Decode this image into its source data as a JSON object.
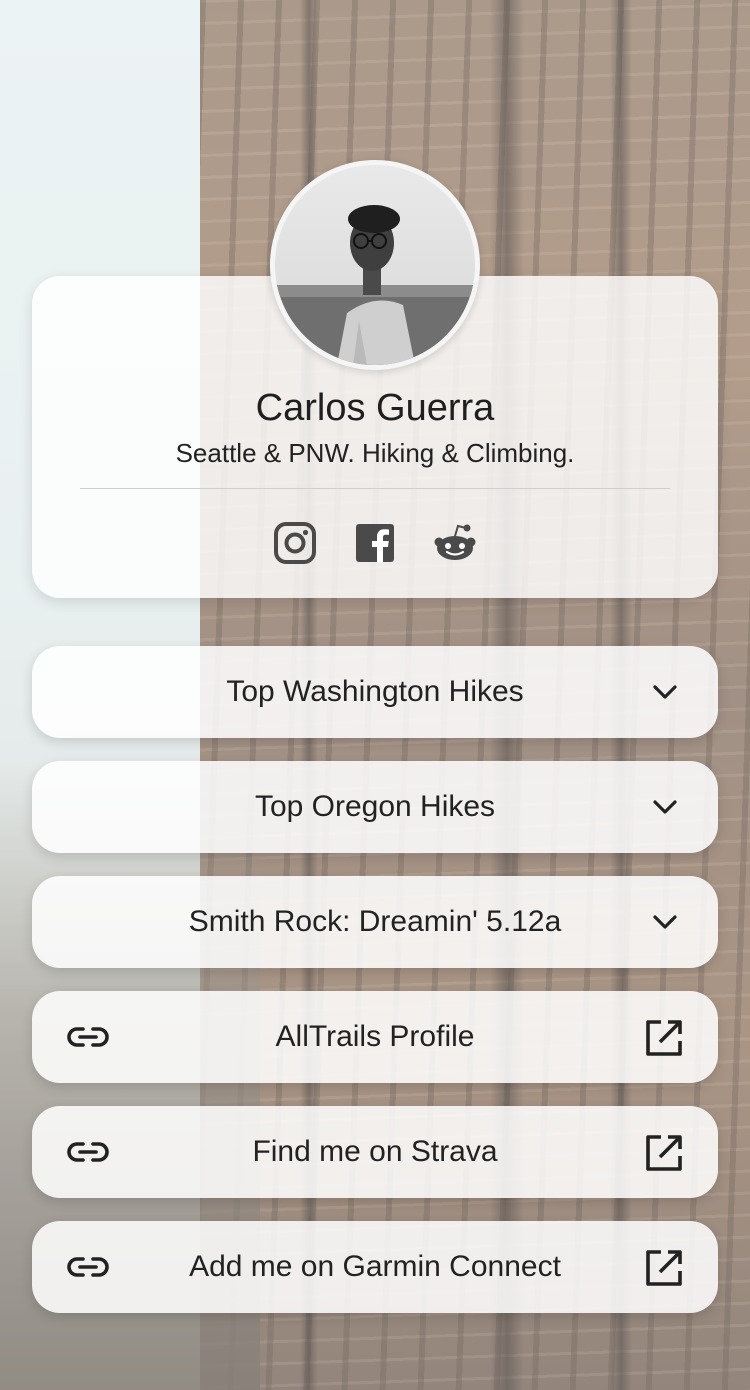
{
  "profile": {
    "name": "Carlos Guerra",
    "bio": "Seattle & PNW. Hiking & Climbing."
  },
  "social": [
    {
      "name": "instagram",
      "icon": "instagram-icon"
    },
    {
      "name": "facebook",
      "icon": "facebook-icon"
    },
    {
      "name": "reddit",
      "icon": "reddit-icon"
    }
  ],
  "links": [
    {
      "label": "Top Washington Hikes",
      "type": "expandable",
      "icon": "chevron-down-icon"
    },
    {
      "label": "Top Oregon Hikes",
      "type": "expandable",
      "icon": "chevron-down-icon"
    },
    {
      "label": "Smith Rock: Dreamin' 5.12a",
      "type": "expandable",
      "icon": "chevron-down-icon"
    },
    {
      "label": "AllTrails Profile",
      "type": "external",
      "icon": "external-link-icon"
    },
    {
      "label": "Find me on Strava",
      "type": "external",
      "icon": "external-link-icon"
    },
    {
      "label": "Add me on Garmin Connect",
      "type": "external",
      "icon": "external-link-icon"
    }
  ],
  "colors": {
    "text": "#222222",
    "icon": "#4a4a4a",
    "card_bg": "#ffffff"
  }
}
